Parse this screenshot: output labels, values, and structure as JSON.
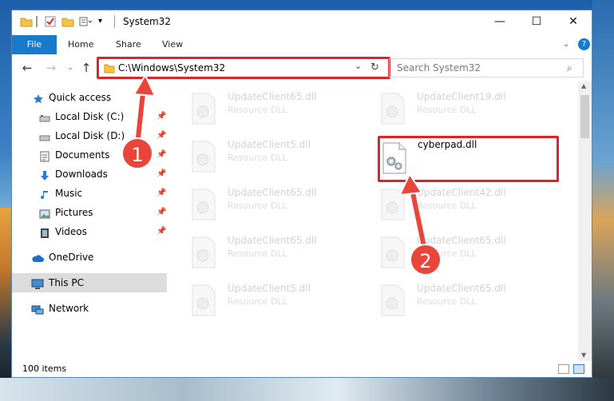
{
  "window": {
    "title": "System32",
    "controls": {
      "minimize": "—",
      "maximize": "☐",
      "close": "✕"
    }
  },
  "ribbon": {
    "file_tab": "File",
    "tabs": [
      "Home",
      "Share",
      "View"
    ]
  },
  "address_bar": {
    "path": "C:\\Windows\\System32",
    "search_placeholder": "Search System32"
  },
  "sidebar": {
    "quick_access": "Quick access",
    "items": [
      {
        "label": "Local Disk (C:)",
        "icon": "drive-icon",
        "pinned": true
      },
      {
        "label": "Local Disk (D:)",
        "icon": "drive-icon",
        "pinned": true
      },
      {
        "label": "Documents",
        "icon": "documents-icon",
        "pinned": true
      },
      {
        "label": "Downloads",
        "icon": "downloads-icon",
        "pinned": true
      },
      {
        "label": "Music",
        "icon": "music-icon",
        "pinned": true
      },
      {
        "label": "Pictures",
        "icon": "pictures-icon",
        "pinned": true
      },
      {
        "label": "Videos",
        "icon": "videos-icon",
        "pinned": true
      }
    ],
    "onedrive": "OneDrive",
    "this_pc": "This PC",
    "network": "Network"
  },
  "files": [
    {
      "name": "UpdateClient65.dll",
      "type": "Resource DLL"
    },
    {
      "name": "UpdateClient19.dll",
      "type": "Resource DLL"
    },
    {
      "name": "UpdateClient5.dll",
      "type": "Resource DLL"
    },
    {
      "name": "cyberpad.dll",
      "type": ""
    },
    {
      "name": "UpdateClient65.dll",
      "type": "Resource DLL"
    },
    {
      "name": "UpdateClient42.dll",
      "type": "Resource DLL"
    },
    {
      "name": "UpdateClient65.dll",
      "type": "Resource DLL"
    },
    {
      "name": "UpdateClient65.dll",
      "type": "Resource DLL"
    },
    {
      "name": "UpdateClient5.dll",
      "type": "Resource DLL"
    },
    {
      "name": "UpdateClient65.dll",
      "type": "Resource DLL"
    }
  ],
  "status": {
    "item_count": "100 items"
  },
  "annotations": {
    "step1": "1",
    "step2": "2"
  },
  "colors": {
    "accent": "#1979ca",
    "highlight": "#d9262d",
    "badge": "#e9453a"
  }
}
